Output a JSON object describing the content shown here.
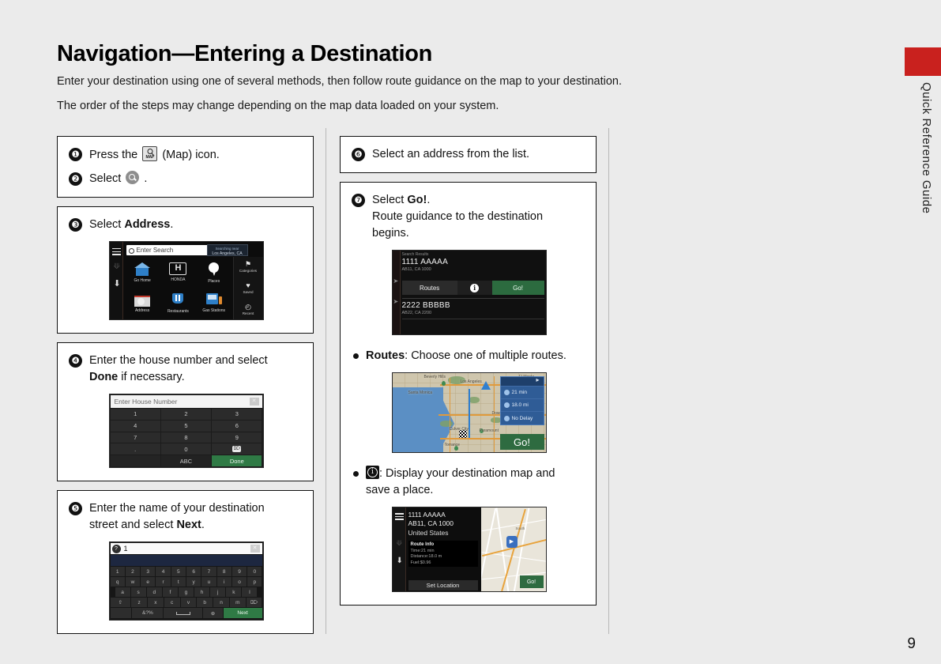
{
  "header": {
    "title": "Navigation—Entering a Destination",
    "line1": "Enter your destination using one of several methods, then follow route guidance on the map to your destination.",
    "line2": "The order of the steps may change depending on the map data loaded on your system."
  },
  "side": {
    "tab_label": "Quick Reference Guide",
    "page_number": "9"
  },
  "steps": {
    "s1": {
      "num": "❶",
      "pre": "Press the",
      "post": "(Map) icon."
    },
    "s2": {
      "num": "❷",
      "pre": "Select",
      "post": "."
    },
    "s3": {
      "num": "❸",
      "pre": "Select",
      "bold": "Address",
      "post": "."
    },
    "s4": {
      "num": "❹",
      "l1a": "Enter the house number and select",
      "l2bold": "Done",
      "l2b": "if necessary."
    },
    "s5": {
      "num": "❺",
      "l1": "Enter the name of your destination",
      "l2a": "street and select",
      "l2bold": "Next",
      "l2b": "."
    },
    "s6": {
      "num": "❻",
      "text": "Select an address from the list."
    },
    "s7": {
      "num": "❼",
      "l1a": "Select",
      "l1bold": "Go!",
      "l1b": ".",
      "l2": "Route guidance to the destination",
      "l3": "begins."
    }
  },
  "bullets": {
    "routes": {
      "bold": "Routes",
      "text": ": Choose one of multiple routes."
    },
    "info": {
      "text": ": Display your destination map and",
      "text2": "save a place."
    }
  },
  "screen_home": {
    "search_placeholder": "Enter Search",
    "near_label": "Searching near",
    "near_value": "Los Angeles, CA",
    "tiles": [
      {
        "label": "Go Home",
        "icon": "home-icon"
      },
      {
        "label": "HONDA",
        "icon": "honda-icon"
      },
      {
        "label": "Places",
        "icon": "map-pin-icon"
      },
      {
        "label": "Address",
        "icon": "address-icon"
      },
      {
        "label": "Restaurants",
        "icon": "restaurant-icon"
      },
      {
        "label": "Gas Stations",
        "icon": "gas-station-icon"
      }
    ],
    "side_items": [
      {
        "label": "Categories",
        "glyph": "⚑"
      },
      {
        "label": "Saved",
        "glyph": "♥"
      },
      {
        "label": "Recent",
        "glyph": "◴"
      }
    ]
  },
  "screen_keypad": {
    "placeholder": "Enter House Number",
    "keys": [
      "1",
      "2",
      "3",
      "4",
      "5",
      "6",
      "7",
      "8",
      "9",
      ".",
      "0"
    ],
    "backspace": "⌦",
    "abc_label": "ABC",
    "done_label": "Done",
    "close_label": "✕"
  },
  "screen_keyboard": {
    "value": "1",
    "help_label": "?",
    "close_label": "✕",
    "row_num": [
      "1",
      "2",
      "3",
      "4",
      "5",
      "6",
      "7",
      "8",
      "9",
      "0"
    ],
    "row_q": [
      "q",
      "w",
      "e",
      "r",
      "t",
      "y",
      "u",
      "i",
      "o",
      "p"
    ],
    "row_a": [
      "a",
      "s",
      "d",
      "f",
      "g",
      "h",
      "j",
      "k",
      "l"
    ],
    "row_z": [
      "⇧",
      "z",
      "x",
      "c",
      "v",
      "b",
      "n",
      "m",
      "⌦"
    ],
    "sym_label": "&?%",
    "globe_label": "⊕",
    "next_label": "Next"
  },
  "screen_results": {
    "header": "Search Results",
    "result1": {
      "name": "1111 AAAAA",
      "sub": "AB11, CA 1000"
    },
    "result2": {
      "name": "2222 BBBBB",
      "sub": "AB22, CA 2200"
    },
    "routes_label": "Routes",
    "info_label": "i",
    "go_label": "Go!"
  },
  "screen_routemap": {
    "time": "21 min",
    "distance": "18.0 mi",
    "traffic": "No Delay",
    "go_label": "Go!",
    "map_labels": [
      "Santa Monica",
      "Los Angeles",
      "El Monte",
      "Paramount",
      "Torrance",
      "Beverly Hills",
      "Culver City",
      "Downey"
    ]
  },
  "screen_destination": {
    "addr_line1": "1111 AAAAA",
    "addr_line2": "AB11, CA 1000",
    "country": "United States",
    "route_info_title": "Route Info",
    "route_info_time": "Time:21 min",
    "route_info_distance": "Distance:18.0 m",
    "route_info_fuel": "Fuel:$0.96",
    "set_location_label": "Set Location",
    "go_label": "Go!"
  },
  "colors": {
    "accent_red": "#c9211e",
    "go_green": "#2e6b40",
    "panel_blue": "#2f5c96"
  }
}
